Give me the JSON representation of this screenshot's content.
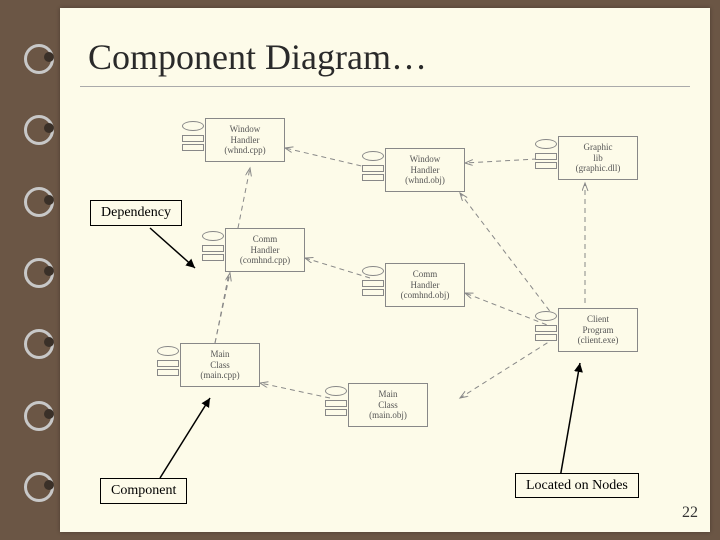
{
  "title": "Component Diagram…",
  "pageNumber": "22",
  "callouts": {
    "dependency": "Dependency",
    "component": "Component",
    "located": "Located on Nodes"
  },
  "components": {
    "windowHandlerCpp": {
      "line1": "Window",
      "line2": "Handler",
      "line3": "(whnd.cpp)"
    },
    "windowHandlerObj": {
      "line1": "Window",
      "line2": "Handler",
      "line3": "(whnd.obj)"
    },
    "graphicLib": {
      "line1": "Graphic",
      "line2": "lib",
      "line3": "(graphic.dll)"
    },
    "commHandlerCpp": {
      "line1": "Comm",
      "line2": "Handler",
      "line3": "(comhnd.cpp)"
    },
    "commHandlerObj": {
      "line1": "Comm",
      "line2": "Handler",
      "line3": "(comhnd.obj)"
    },
    "clientProgram": {
      "line1": "Client",
      "line2": "Program",
      "line3": "(client.exe)"
    },
    "mainClassCpp": {
      "line1": "Main",
      "line2": "Class",
      "line3": "(main.cpp)"
    },
    "mainClassObj": {
      "line1": "Main",
      "line2": "Class",
      "line3": "(main.obj)"
    }
  }
}
